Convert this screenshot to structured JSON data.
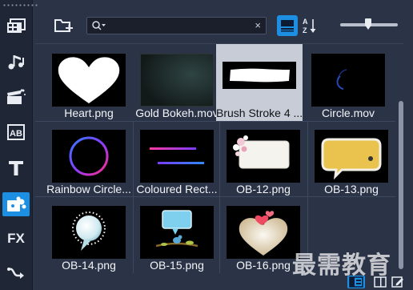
{
  "rail": {
    "items": [
      {
        "name": "media",
        "icon": "media-library-icon"
      },
      {
        "name": "audio",
        "icon": "music-note-icon"
      },
      {
        "name": "effects",
        "icon": "magic-clapper-icon"
      },
      {
        "name": "titles-text",
        "icon": "ab-text-icon"
      },
      {
        "name": "text",
        "icon": "t-text-icon"
      },
      {
        "name": "graphics",
        "icon": "graphics-puzzle-icon",
        "active": true
      },
      {
        "name": "fx",
        "label": "FX"
      },
      {
        "name": "motion",
        "icon": "motion-path-icon"
      }
    ]
  },
  "toolbar": {
    "search_value": "",
    "clear_label": "×"
  },
  "zoom": {
    "level": 0.48
  },
  "tiles": [
    {
      "label": "Heart.png"
    },
    {
      "label": "Gold Bokeh.mov"
    },
    {
      "label": "Brush Stroke 4 ..."
    },
    {
      "label": "Circle.mov"
    },
    {
      "label": "Rainbow Circle..."
    },
    {
      "label": "Coloured Rect..."
    },
    {
      "label": "OB-12.png"
    },
    {
      "label": "OB-13.png"
    },
    {
      "label": "OB-14.png"
    },
    {
      "label": "OB-15.png"
    },
    {
      "label": "OB-16.png"
    }
  ],
  "watermark": "最需教育",
  "colors": {
    "accent": "#1c8fe3",
    "background": "#2b3347",
    "selected_tile": "#c8ccd6"
  }
}
